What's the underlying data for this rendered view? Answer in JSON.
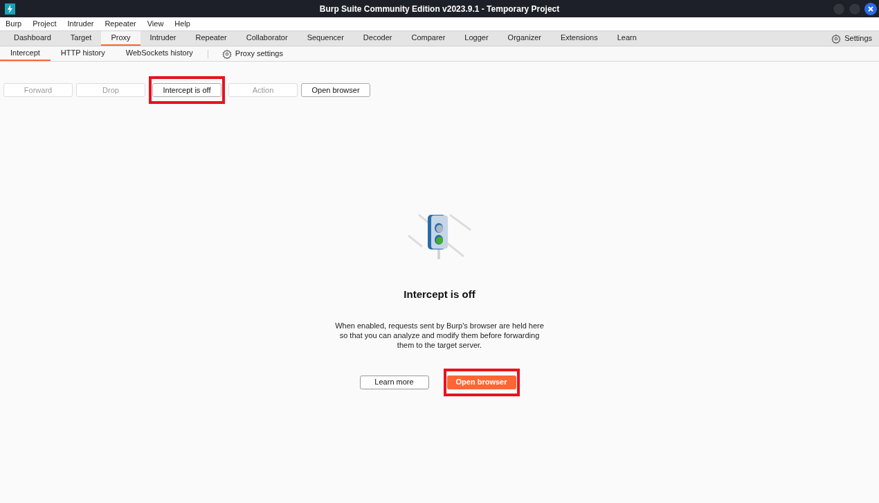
{
  "window": {
    "title": "Burp Suite Community Edition v2023.9.1 - Temporary Project"
  },
  "menu": [
    "Burp",
    "Project",
    "Intruder",
    "Repeater",
    "View",
    "Help"
  ],
  "tabs": [
    {
      "label": "Dashboard",
      "selected": false
    },
    {
      "label": "Target",
      "selected": false
    },
    {
      "label": "Proxy",
      "selected": true
    },
    {
      "label": "Intruder",
      "selected": false
    },
    {
      "label": "Repeater",
      "selected": false
    },
    {
      "label": "Collaborator",
      "selected": false
    },
    {
      "label": "Sequencer",
      "selected": false
    },
    {
      "label": "Decoder",
      "selected": false
    },
    {
      "label": "Comparer",
      "selected": false
    },
    {
      "label": "Logger",
      "selected": false
    },
    {
      "label": "Organizer",
      "selected": false
    },
    {
      "label": "Extensions",
      "selected": false
    },
    {
      "label": "Learn",
      "selected": false
    }
  ],
  "settings": "Settings",
  "subtabs": [
    {
      "label": "Intercept",
      "selected": true
    },
    {
      "label": "HTTP history",
      "selected": false
    },
    {
      "label": "WebSockets history",
      "selected": false
    }
  ],
  "proxy_settings": "Proxy settings",
  "toolbar": [
    {
      "label": "Forward",
      "disabled": true,
      "highlighted": false
    },
    {
      "label": "Drop",
      "disabled": true,
      "highlighted": false
    },
    {
      "label": "Intercept is off",
      "disabled": false,
      "highlighted": true
    },
    {
      "label": "Action",
      "disabled": true,
      "highlighted": false
    },
    {
      "label": "Open browser",
      "disabled": false,
      "highlighted": false
    }
  ],
  "empty_state": {
    "heading": "Intercept is off",
    "message": [
      "When enabled, requests sent by Burp's browser are held here",
      "so that you can analyze and modify them before forwarding",
      "them to the target server."
    ],
    "buttons": [
      {
        "label": "Learn more",
        "kind": "outline",
        "highlighted": false
      },
      {
        "label": "Open browser",
        "kind": "primary",
        "highlighted": true
      }
    ]
  }
}
